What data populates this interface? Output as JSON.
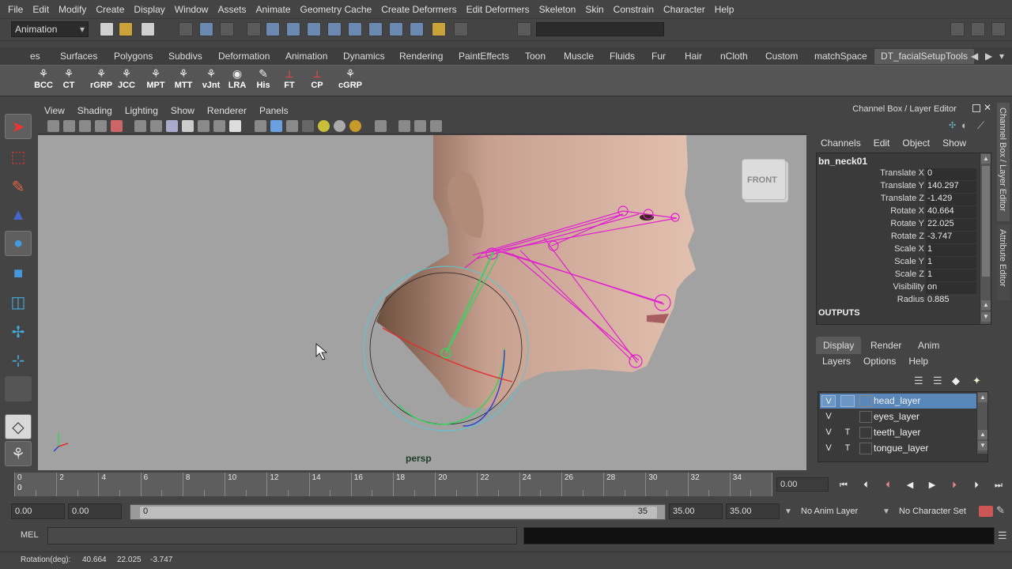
{
  "menubar": {
    "items": [
      "File",
      "Edit",
      "Modify",
      "Create",
      "Display",
      "Window",
      "Assets",
      "Animate",
      "Geometry Cache",
      "Create Deformers",
      "Edit Deformers",
      "Skeleton",
      "Skin",
      "Constrain",
      "Character",
      "Help"
    ]
  },
  "statusline": {
    "mode": "Animation"
  },
  "shelf": {
    "tabs": [
      "es",
      "Surfaces",
      "Polygons",
      "Subdivs",
      "Deformation",
      "Animation",
      "Dynamics",
      "Rendering",
      "PaintEffects",
      "Toon",
      "Muscle",
      "Fluids",
      "Fur",
      "Hair",
      "nCloth",
      "Custom",
      "matchSpace",
      "DT_facialSetupTools"
    ],
    "buttons": [
      "BCC",
      "CT",
      "rGRP",
      "JCC",
      "MPT",
      "MTT",
      "vJnt",
      "LRA",
      "His",
      "FT",
      "CP",
      "cGRP"
    ]
  },
  "viewport": {
    "menu": [
      "View",
      "Shading",
      "Lighting",
      "Show",
      "Renderer",
      "Panels"
    ],
    "camera": "persp",
    "cube_label": "FRONT"
  },
  "channel_box": {
    "title": "Channel Box / Layer Editor",
    "menu": [
      "Channels",
      "Edit",
      "Object",
      "Show"
    ],
    "node": "bn_neck01",
    "attributes": [
      {
        "name": "Translate X",
        "value": "0"
      },
      {
        "name": "Translate Y",
        "value": "140.297"
      },
      {
        "name": "Translate Z",
        "value": "-1.429"
      },
      {
        "name": "Rotate X",
        "value": "40.664"
      },
      {
        "name": "Rotate Y",
        "value": "22.025"
      },
      {
        "name": "Rotate Z",
        "value": "-3.747"
      },
      {
        "name": "Scale X",
        "value": "1"
      },
      {
        "name": "Scale Y",
        "value": "1"
      },
      {
        "name": "Scale Z",
        "value": "1"
      },
      {
        "name": "Visibility",
        "value": "on"
      },
      {
        "name": "Radius",
        "value": "0.885"
      }
    ],
    "outputs_label": "OUTPUTS"
  },
  "side_tabs": [
    "Channel Box / Layer Editor",
    "Attribute Editor"
  ],
  "layer_editor": {
    "tabs": [
      "Display",
      "Render",
      "Anim"
    ],
    "menu": [
      "Layers",
      "Options",
      "Help"
    ],
    "layers": [
      {
        "vis": "V",
        "tmp": "",
        "name": "head_layer"
      },
      {
        "vis": "V",
        "tmp": "",
        "name": "eyes_layer"
      },
      {
        "vis": "V",
        "tmp": "T",
        "name": "teeth_layer"
      },
      {
        "vis": "V",
        "tmp": "T",
        "name": "tongue_layer"
      }
    ]
  },
  "timeline": {
    "labels": [
      "0",
      "2",
      "4",
      "6",
      "8",
      "10",
      "12",
      "14",
      "16",
      "18",
      "20",
      "22",
      "24",
      "26",
      "28",
      "30",
      "32",
      "34"
    ],
    "current_marker": "0",
    "current_frame": "0.00"
  },
  "range": {
    "start_time": "0.00",
    "playback_start": "0.00",
    "slider_start": "0",
    "slider_end": "35",
    "playback_end": "35.00",
    "end_time": "35.00",
    "anim_layer": "No Anim Layer",
    "character_set": "No Character Set"
  },
  "command_line": {
    "label": "MEL"
  },
  "help_line": {
    "label": "Rotation(deg):",
    "x": "40.664",
    "y": "22.025",
    "z": "-3.747"
  },
  "colors": {
    "viewport_bg": "#a2a2a2",
    "joint_magenta": "#e020d0",
    "joint_green": "#3cd060",
    "layer_selected": "#5a87ba"
  }
}
